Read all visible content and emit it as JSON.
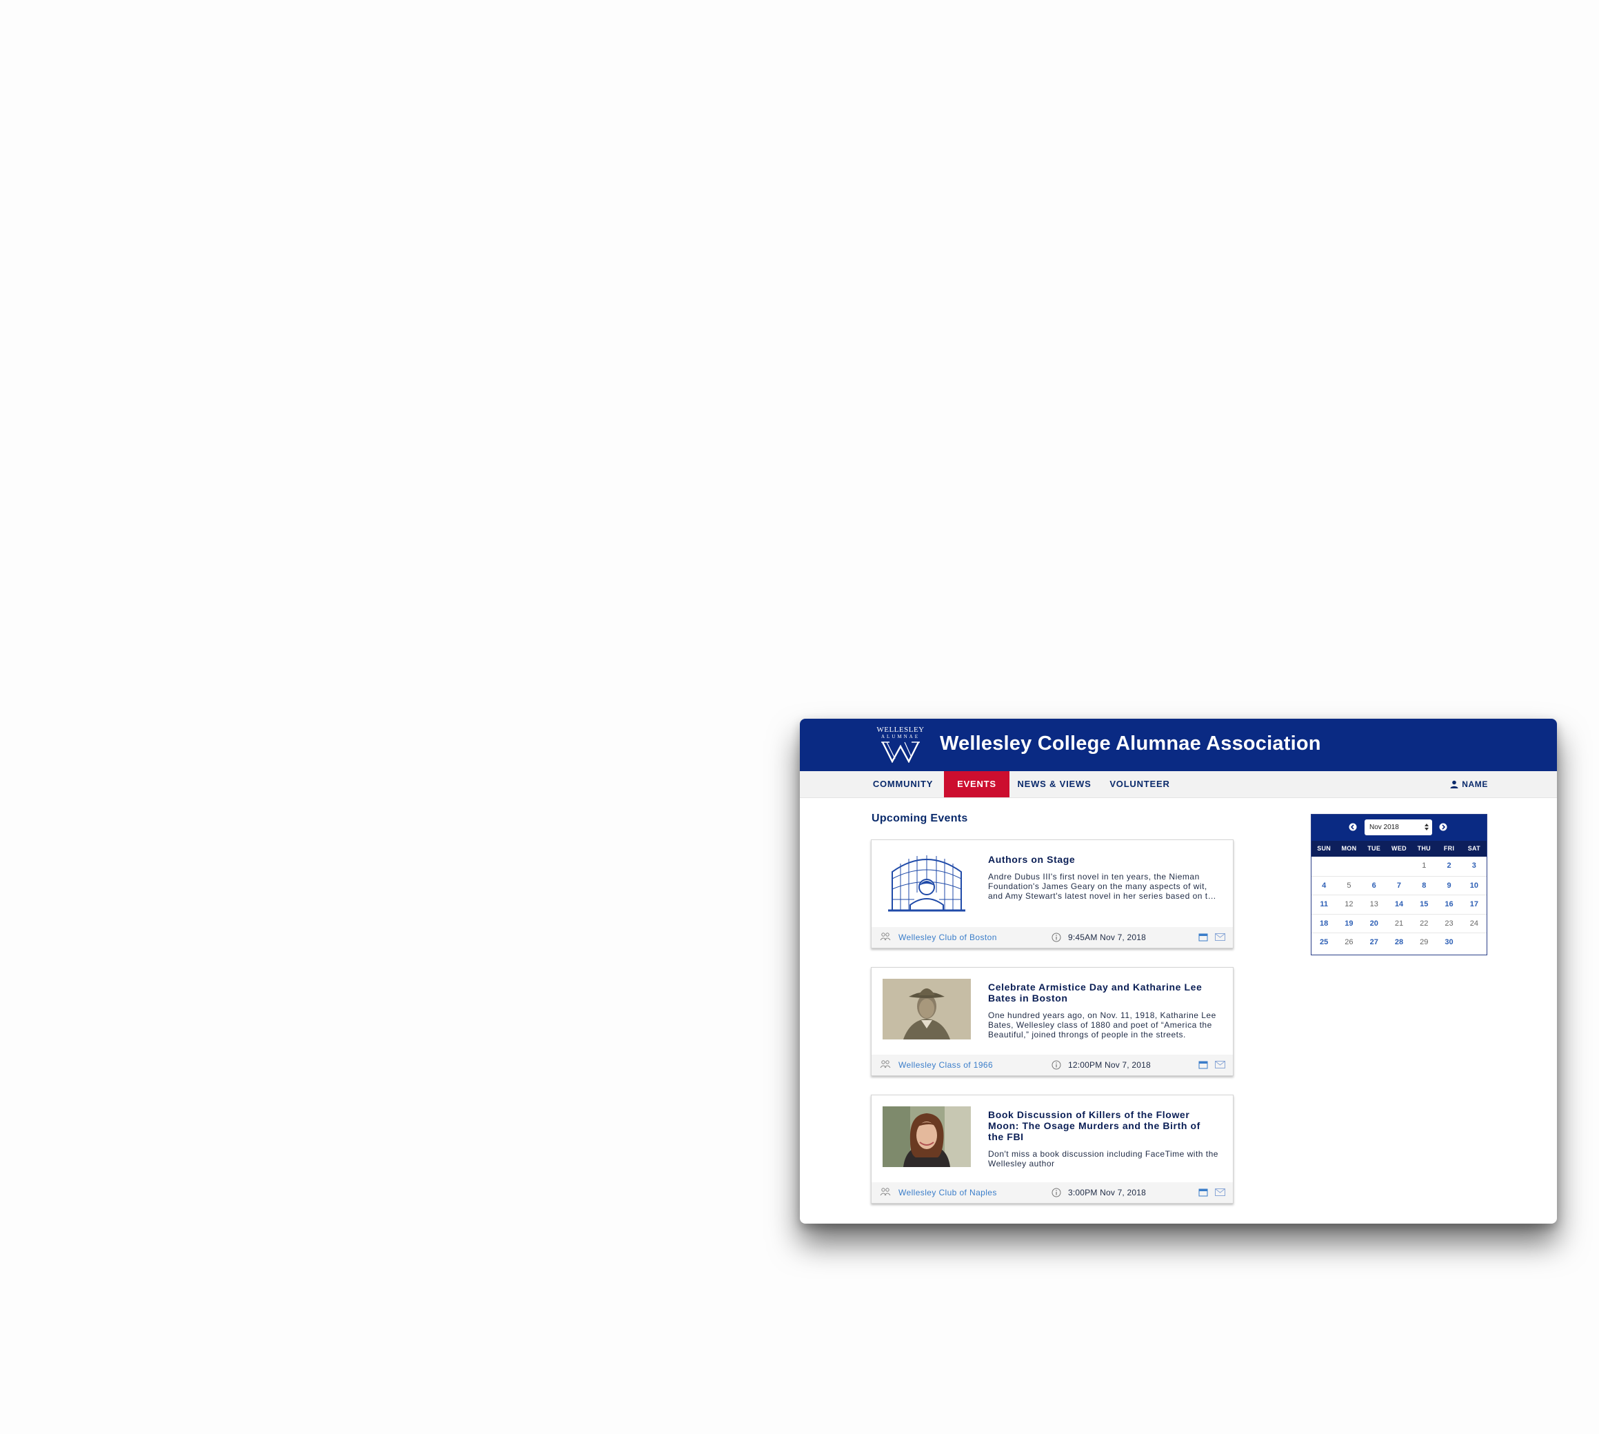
{
  "header": {
    "logo": {
      "line1": "WELLESLEY",
      "line2": "ALUMNAE"
    },
    "title": "Wellesley College Alumnae Association"
  },
  "nav": {
    "items": [
      {
        "label": "COMMUNITY",
        "active": false
      },
      {
        "label": "EVENTS",
        "active": true
      },
      {
        "label": "NEWS & VIEWS",
        "active": false
      },
      {
        "label": "VOLUNTEER",
        "active": false
      }
    ],
    "user_label": "NAME"
  },
  "main": {
    "section_title": "Upcoming Events",
    "events": [
      {
        "title": "Authors on Stage",
        "description": "Andre Dubus III's first novel in ten years, the Nieman Foundation's James Geary on the many aspects of wit, and Amy Stewart's latest novel in her series based on the real-life story of New Jersey's first female deputy sheriff.",
        "club": "Wellesley Club of Boston",
        "time": "9:45AM  Nov 7, 2018",
        "image": "line-art-illustration"
      },
      {
        "title": "Celebrate Armistice Day and Katharine Lee Bates in Boston",
        "description": "One hundred years ago, on Nov. 11, 1918, Katharine Lee Bates, Wellesley class of 1880 and poet of “America the Beautiful,” joined throngs of people in the streets.",
        "club": "Wellesley Class of 1966",
        "time": "12:00PM  Nov 7, 2018",
        "image": "soldier-portrait-photo"
      },
      {
        "title": "Book Discussion of Killers of the Flower Moon:  The Osage Murders and the Birth of the FBI",
        "description": "Don't miss a book discussion including FaceTime with the Wellesley author",
        "club": "Wellesley Club of Naples",
        "time": "3:00PM  Nov 7, 2018",
        "image": "author-portrait-photo"
      }
    ]
  },
  "calendar": {
    "month_select": "Nov 2018",
    "weekdays": [
      "SUN",
      "MON",
      "TUE",
      "WED",
      "THU",
      "FRI",
      "SAT"
    ],
    "weeks": [
      [
        {
          "d": ""
        },
        {
          "d": ""
        },
        {
          "d": ""
        },
        {
          "d": ""
        },
        {
          "d": "1",
          "ev": false
        },
        {
          "d": "2",
          "ev": true
        },
        {
          "d": "3",
          "ev": true
        }
      ],
      [
        {
          "d": "4",
          "ev": true
        },
        {
          "d": "5",
          "ev": false
        },
        {
          "d": "6",
          "ev": true
        },
        {
          "d": "7",
          "ev": true
        },
        {
          "d": "8",
          "ev": true
        },
        {
          "d": "9",
          "ev": true
        },
        {
          "d": "10",
          "ev": true
        }
      ],
      [
        {
          "d": "11",
          "ev": true
        },
        {
          "d": "12",
          "ev": false
        },
        {
          "d": "13",
          "ev": false
        },
        {
          "d": "14",
          "ev": true
        },
        {
          "d": "15",
          "ev": true
        },
        {
          "d": "16",
          "ev": true
        },
        {
          "d": "17",
          "ev": true
        }
      ],
      [
        {
          "d": "18",
          "ev": true
        },
        {
          "d": "19",
          "ev": true
        },
        {
          "d": "20",
          "ev": true
        },
        {
          "d": "21",
          "ev": false
        },
        {
          "d": "22",
          "ev": false
        },
        {
          "d": "23",
          "ev": false
        },
        {
          "d": "24",
          "ev": false
        }
      ],
      [
        {
          "d": "25",
          "ev": true
        },
        {
          "d": "26",
          "ev": false
        },
        {
          "d": "27",
          "ev": true
        },
        {
          "d": "28",
          "ev": true
        },
        {
          "d": "29",
          "ev": false
        },
        {
          "d": "30",
          "ev": true
        },
        {
          "d": ""
        }
      ]
    ]
  },
  "colors": {
    "brand_navy": "#0a2a83",
    "active_red": "#cc0e2f",
    "link_blue": "#3a7dc9"
  }
}
